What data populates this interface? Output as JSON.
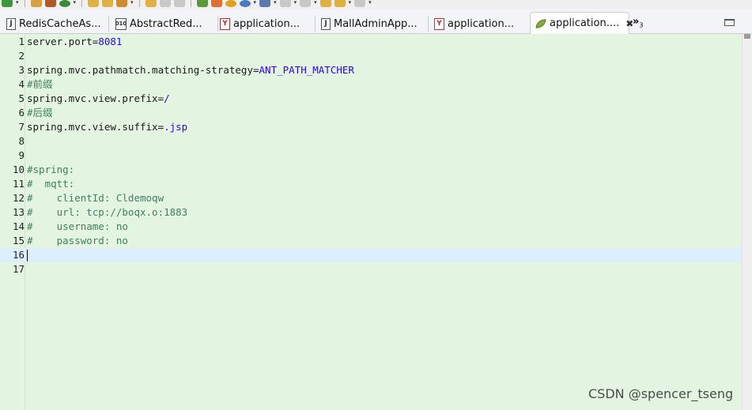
{
  "tabs": [
    {
      "label": "RedisCacheAs...",
      "icon": "java-file-icon"
    },
    {
      "label": "AbstractRed...",
      "icon": "class-file-icon"
    },
    {
      "label": "application...",
      "icon": "yaml-file-icon"
    },
    {
      "label": "MallAdminApp...",
      "icon": "java-file-icon"
    },
    {
      "label": "application...",
      "icon": "yaml-file-icon"
    },
    {
      "label": "application....",
      "icon": "spring-properties-icon",
      "active": true,
      "close": "✖"
    }
  ],
  "overflow": {
    "chevrons": "»",
    "count": "3"
  },
  "editor": {
    "line_numbers": [
      "1",
      "2",
      "3",
      "4",
      "5",
      "6",
      "7",
      "8",
      "9",
      "10",
      "11",
      "12",
      "13",
      "14",
      "15",
      "16",
      "17"
    ],
    "lines": [
      {
        "key": "server.port",
        "eq": "=",
        "value": "8081"
      },
      {},
      {
        "key": "spring.mvc.pathmatch.matching-strategy",
        "eq": "=",
        "value": "ANT_PATH_MATCHER"
      },
      {
        "comment": "#前缀"
      },
      {
        "key": "spring.mvc.view.prefix",
        "eq": "=",
        "value": "/"
      },
      {
        "comment": "#后缀"
      },
      {
        "key": "spring.mvc.view.suffix",
        "eq": "=",
        "value": ".jsp"
      },
      {},
      {},
      {
        "comment": "#spring:"
      },
      {
        "comment": "#  mqtt:"
      },
      {
        "comment": "#    clientId: Cldemoqw"
      },
      {
        "comment": "#    url: tcp://boqx.o:1883"
      },
      {
        "comment": "#    username: no"
      },
      {
        "comment": "#    password: no"
      },
      {},
      {}
    ],
    "current_line": 16
  },
  "watermark": "CSDN @spencer_tseng",
  "colors": {
    "editor_bg": "#e3f5e1",
    "value": "#2a00ff",
    "comment": "#3f7f5f",
    "current_line": "#ddeeff"
  }
}
